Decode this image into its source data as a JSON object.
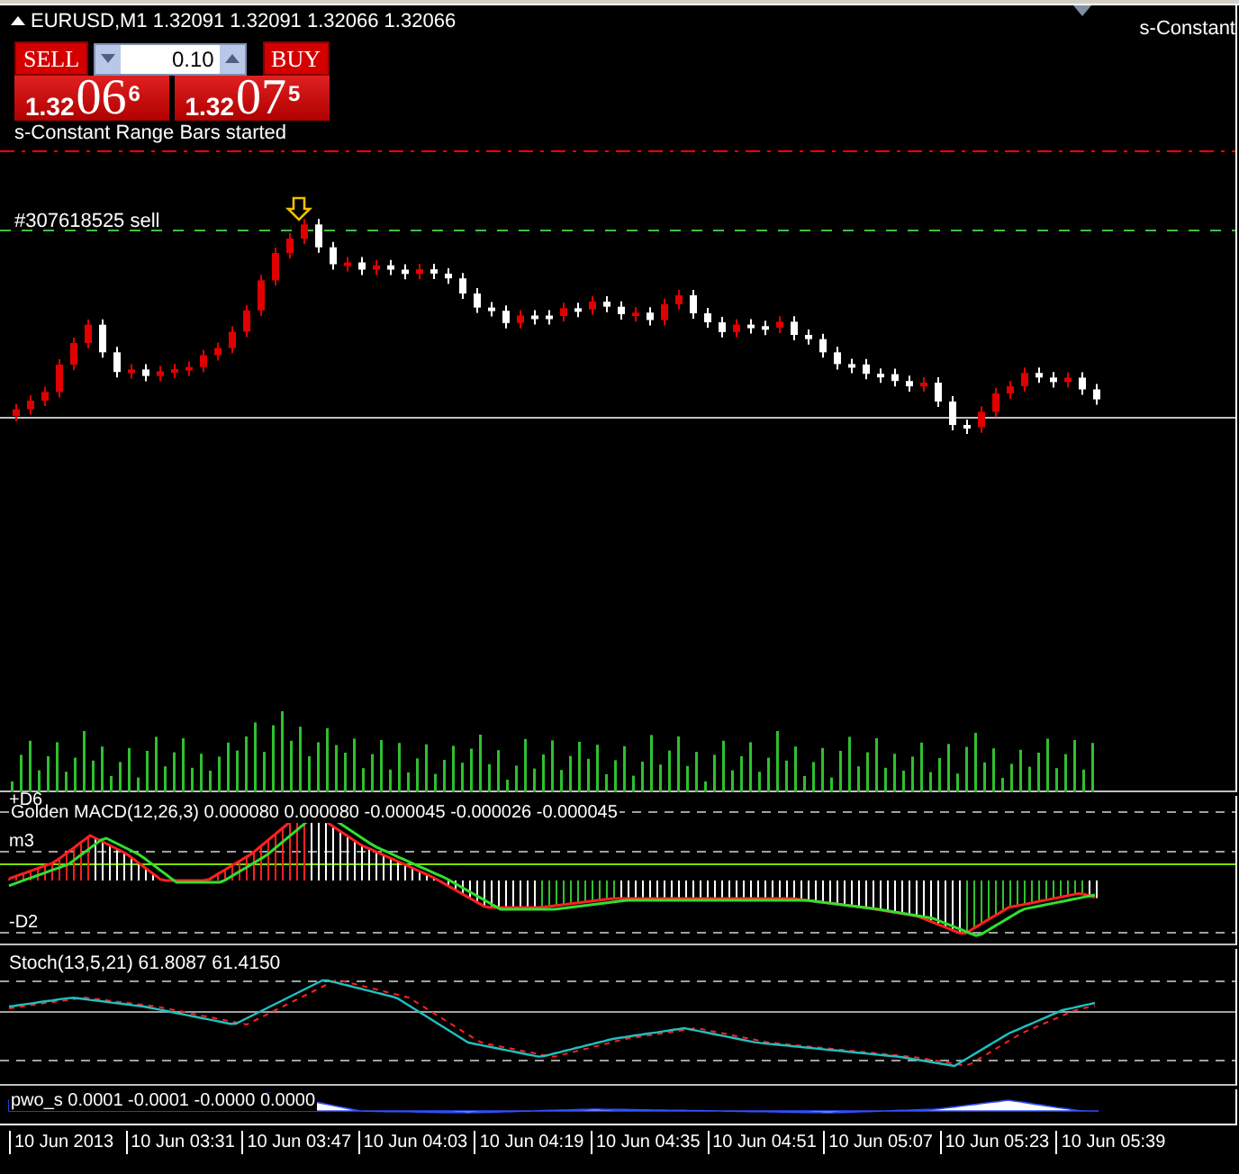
{
  "chart": {
    "header": "EURUSD,M1  1.32091 1.32091 1.32066 1.32066",
    "status_message": "s-Constant Range Bars started",
    "indicator_label": "s-Constant",
    "order_label": "#307618525 sell"
  },
  "trade_panel": {
    "sell": {
      "label": "SELL",
      "price_prefix": "1.32",
      "price_big": "06",
      "price_sup": "6"
    },
    "lot": "0.10",
    "buy": {
      "label": "BUY",
      "price_prefix": "1.32",
      "price_big": "07",
      "price_sup": "5"
    }
  },
  "macd": {
    "scale_top": "+D6",
    "label": "Golden MACD(12,26,3) 0.000080 0.000080 -0.000045 -0.000026 -0.000045",
    "level_high": "m3",
    "level_low": "-D2"
  },
  "stoch": {
    "label": "Stoch(13,5,21) 61.8087 61.4150"
  },
  "pwo": {
    "label": "pwo_s 0.0001 -0.0001 -0.0000 0.0000"
  },
  "time_axis": [
    "10 Jun 2013",
    "10 Jun 03:31",
    "10 Jun 03:47",
    "10 Jun 04:03",
    "10 Jun 04:19",
    "10 Jun 04:35",
    "10 Jun 04:51",
    "10 Jun 05:07",
    "10 Jun 05:23",
    "10 Jun 05:39"
  ]
}
